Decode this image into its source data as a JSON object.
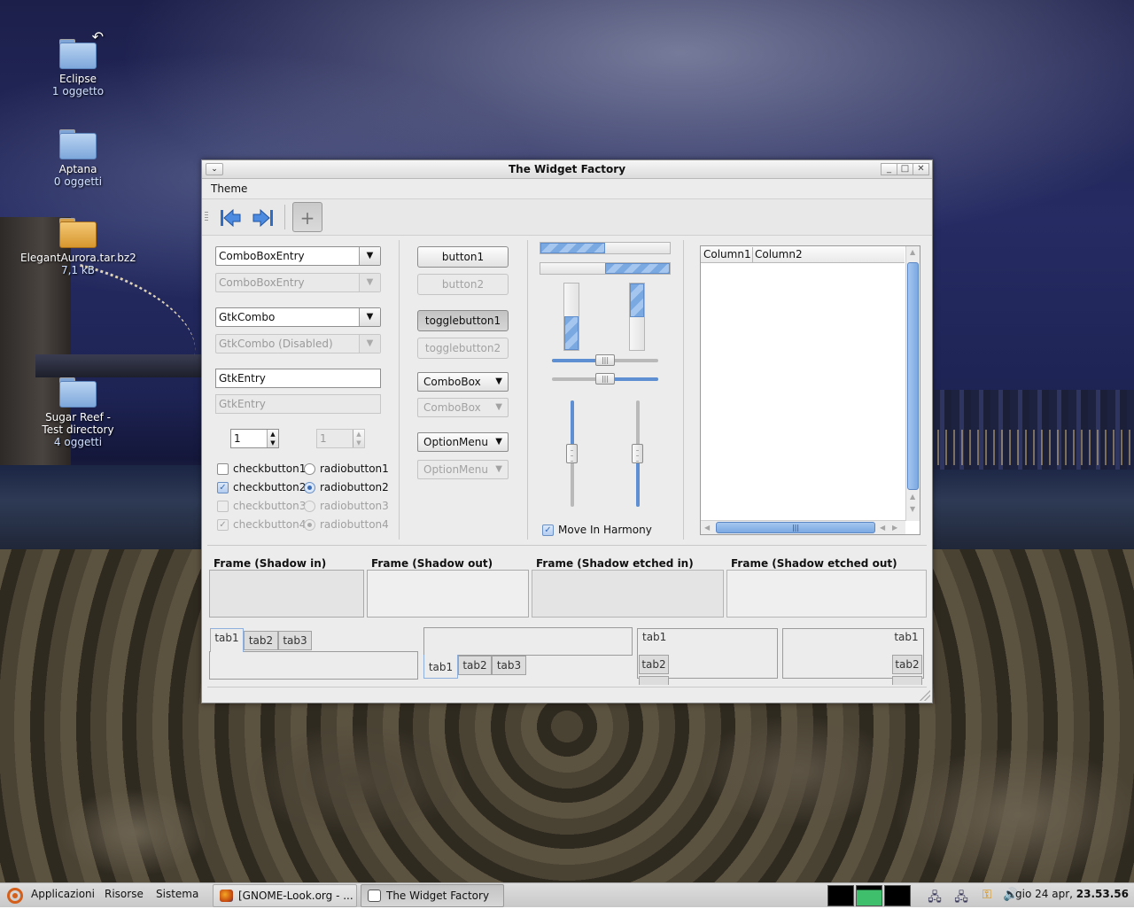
{
  "desktop": {
    "icons": [
      {
        "name": "Eclipse",
        "sub": "1 oggetto"
      },
      {
        "name": "Aptana",
        "sub": "0 oggetti"
      },
      {
        "name": "ElegantAurora.tar.bz2",
        "sub": "7,1 kB"
      },
      {
        "name": "Sugar Reef - Test directory",
        "sub": "4 oggetti"
      }
    ]
  },
  "window": {
    "title": "The Widget Factory",
    "menu": [
      "Theme"
    ],
    "controls": {
      "minimize": "_",
      "maximize": "□",
      "close": "✕",
      "menu": "⌄"
    }
  },
  "toolbar": {
    "icons": [
      "go-first-icon",
      "go-last-icon",
      "add-icon"
    ]
  },
  "col1": {
    "combo_entry": "ComboBoxEntry",
    "combo_entry_disabled": "ComboBoxEntry",
    "gtk_combo": "GtkCombo",
    "gtk_combo_disabled": "GtkCombo (Disabled)",
    "entry": "GtkEntry",
    "entry_disabled": "GtkEntry",
    "spin1": "1",
    "spin2": "1",
    "checks": [
      "checkbutton1",
      "checkbutton2",
      "checkbutton3",
      "checkbutton4"
    ],
    "radios": [
      "radiobutton1",
      "radiobutton2",
      "radiobutton3",
      "radiobutton4"
    ],
    "arrow": "▼"
  },
  "col2": {
    "button1": "button1",
    "button2": "button2",
    "toggle1": "togglebutton1",
    "toggle2": "togglebutton2",
    "combobox": "ComboBox",
    "combobox_disabled": "ComboBox",
    "optionmenu": "OptionMenu",
    "optionmenu_disabled": "OptionMenu"
  },
  "col3": {
    "progress_h1": 0.5,
    "progress_h2": 0.5,
    "progress_v1": 0.5,
    "progress_v2": 0.5,
    "scale_h1": 0.5,
    "scale_h2": 0.5,
    "scale_v1": 0.5,
    "scale_v2": 0.5,
    "harmony_label": "Move In Harmony",
    "harmony_checked": true
  },
  "tree": {
    "columns": [
      "Column1",
      "Column2"
    ]
  },
  "frames": [
    "Frame (Shadow in)",
    "Frame (Shadow out)",
    "Frame (Shadow etched in)",
    "Frame (Shadow etched out)"
  ],
  "notebooks": [
    {
      "tabs": [
        "tab1",
        "tab2",
        "tab3"
      ]
    },
    {
      "tabs": [
        "tab1",
        "tab2",
        "tab3"
      ]
    },
    {
      "tabs": [
        "tab1",
        "tab2"
      ]
    },
    {
      "tabs": [
        "tab1",
        "tab2"
      ]
    }
  ],
  "taskbar": {
    "menus": [
      "Applicazioni",
      "Risorse",
      "Sistema"
    ],
    "tasks": [
      "[GNOME-Look.org - ...",
      "The Widget Factory"
    ],
    "clock_date": "gio 24 apr,",
    "clock_time": "23.53.56"
  },
  "colors": {
    "accent": "#7aa8e0",
    "accent_dark": "#3b6fb6",
    "window_bg": "#ececec"
  }
}
